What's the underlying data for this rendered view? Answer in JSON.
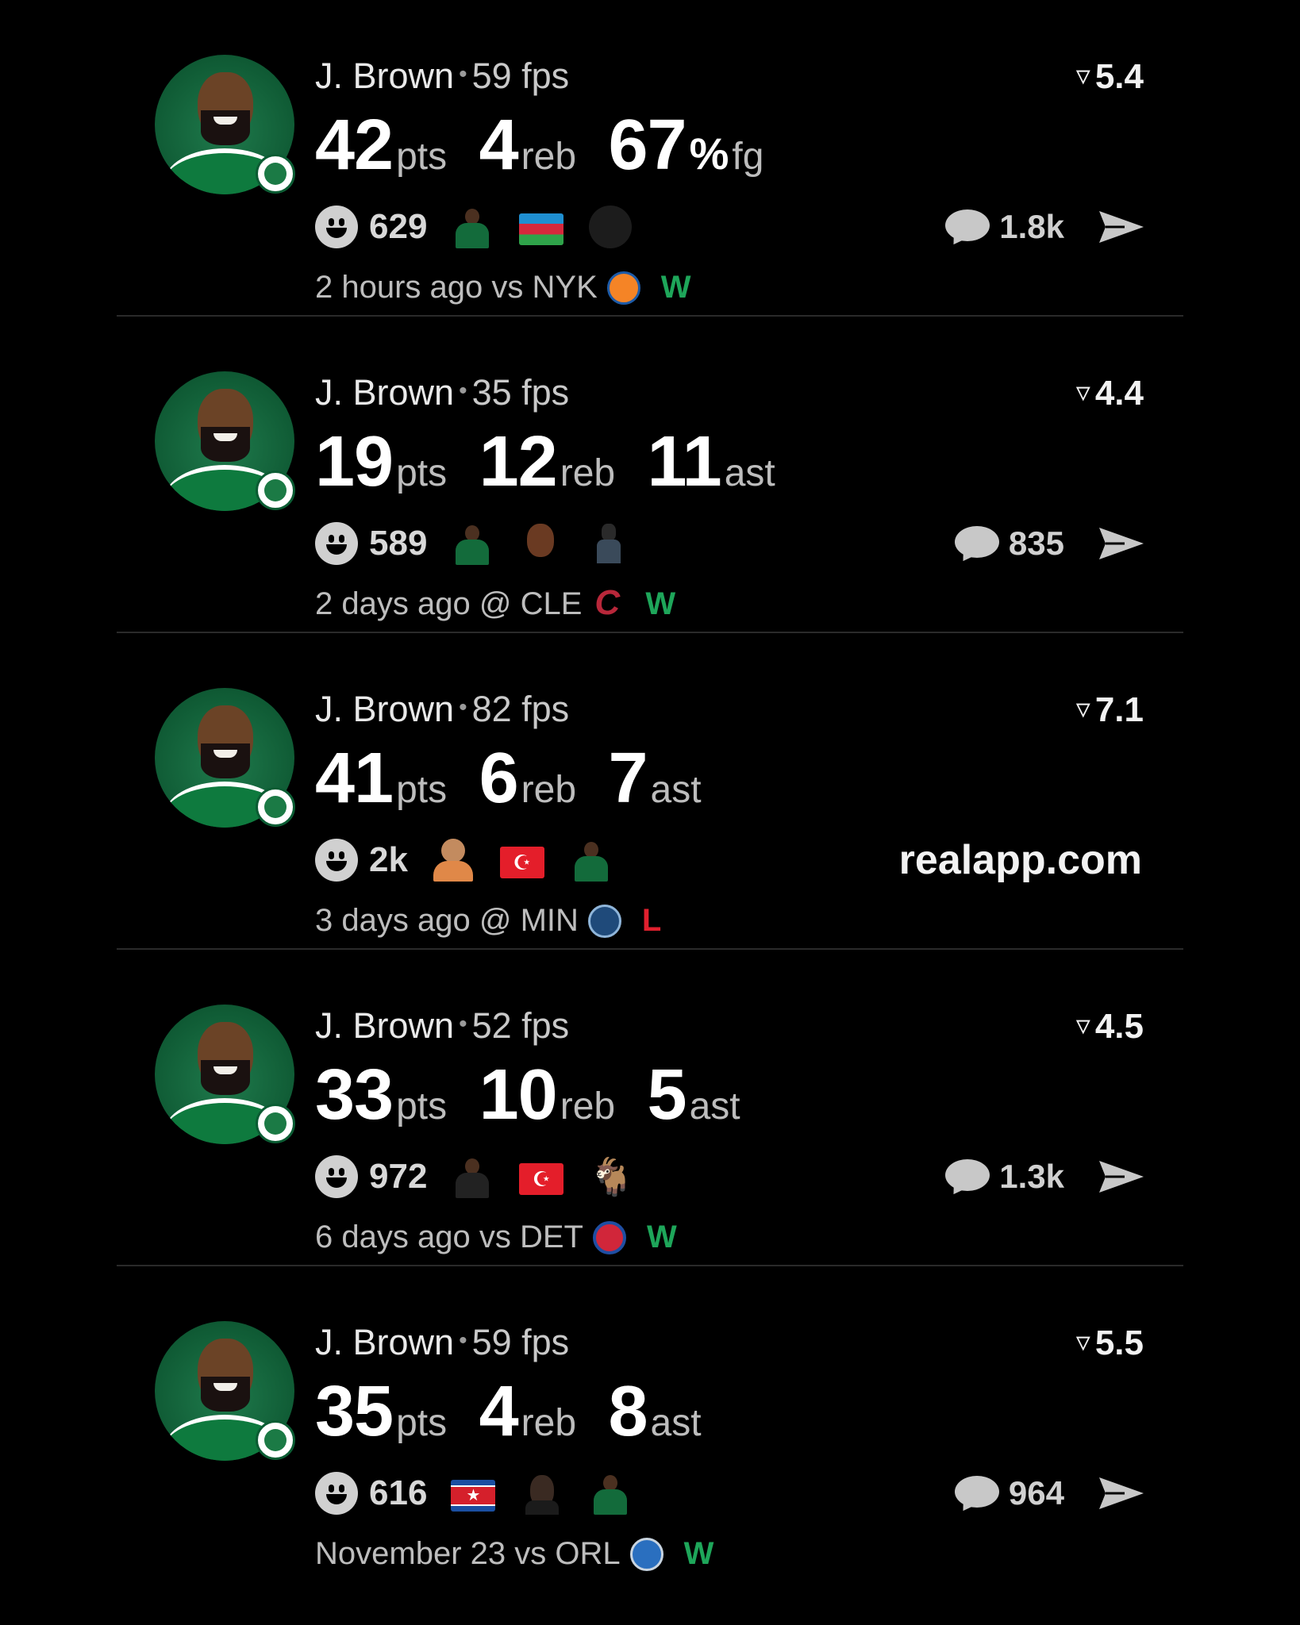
{
  "colors": {
    "background": "#000000",
    "win": "#1ea65a",
    "loss": "#e0202e",
    "divider": "#2a2a2a"
  },
  "posts": [
    {
      "player": "J. Brown",
      "fps": "59 fps",
      "rating": "5.4",
      "stats": [
        {
          "value": "42",
          "unit": "pts"
        },
        {
          "value": "4",
          "unit": "reb"
        },
        {
          "value": "67",
          "pct": "%",
          "unit": "fg"
        }
      ],
      "reaction_count": "629",
      "reaction_thumbs": [
        "player-celtics",
        "azerbaijan-flag",
        "black-circle"
      ],
      "comment_count": "1.8k",
      "time": "2 hours ago",
      "venue": "vs",
      "opponent": "NYK",
      "opponent_logo": "knicks-logo",
      "result": "W"
    },
    {
      "player": "J. Brown",
      "fps": "35 fps",
      "rating": "4.4",
      "stats": [
        {
          "value": "19",
          "unit": "pts"
        },
        {
          "value": "12",
          "unit": "reb"
        },
        {
          "value": "11",
          "unit": "ast"
        }
      ],
      "reaction_count": "589",
      "reaction_thumbs": [
        "player-celtics",
        "face-brown",
        "person-dark"
      ],
      "comment_count": "835",
      "time": "2 days ago",
      "venue": "@",
      "opponent": "CLE",
      "opponent_logo": "cavaliers-logo",
      "result": "W"
    },
    {
      "player": "J. Brown",
      "fps": "82 fps",
      "rating": "7.1",
      "stats": [
        {
          "value": "41",
          "unit": "pts"
        },
        {
          "value": "6",
          "unit": "reb"
        },
        {
          "value": "7",
          "unit": "ast"
        }
      ],
      "reaction_count": "2k",
      "reaction_thumbs": [
        "face-orange",
        "turkey-flag",
        "player-celtics"
      ],
      "promo": "realapp.com",
      "time": "3 days ago",
      "venue": "@",
      "opponent": "MIN",
      "opponent_logo": "timberwolves-logo",
      "result": "L"
    },
    {
      "player": "J. Brown",
      "fps": "52 fps",
      "rating": "4.5",
      "stats": [
        {
          "value": "33",
          "unit": "pts"
        },
        {
          "value": "10",
          "unit": "reb"
        },
        {
          "value": "5",
          "unit": "ast"
        }
      ],
      "reaction_count": "972",
      "reaction_thumbs": [
        "player-nets",
        "turkey-flag",
        "goat"
      ],
      "comment_count": "1.3k",
      "time": "6 days ago",
      "venue": "vs",
      "opponent": "DET",
      "opponent_logo": "pistons-logo",
      "result": "W"
    },
    {
      "player": "J. Brown",
      "fps": "59 fps",
      "rating": "5.5",
      "stats": [
        {
          "value": "35",
          "unit": "pts"
        },
        {
          "value": "4",
          "unit": "reb"
        },
        {
          "value": "8",
          "unit": "ast"
        }
      ],
      "reaction_count": "616",
      "reaction_thumbs": [
        "north-korea-flag",
        "shadow-face",
        "player-celtics"
      ],
      "comment_count": "964",
      "time": "November 23",
      "venue": "vs",
      "opponent": "ORL",
      "opponent_logo": "magic-logo",
      "result": "W"
    }
  ]
}
